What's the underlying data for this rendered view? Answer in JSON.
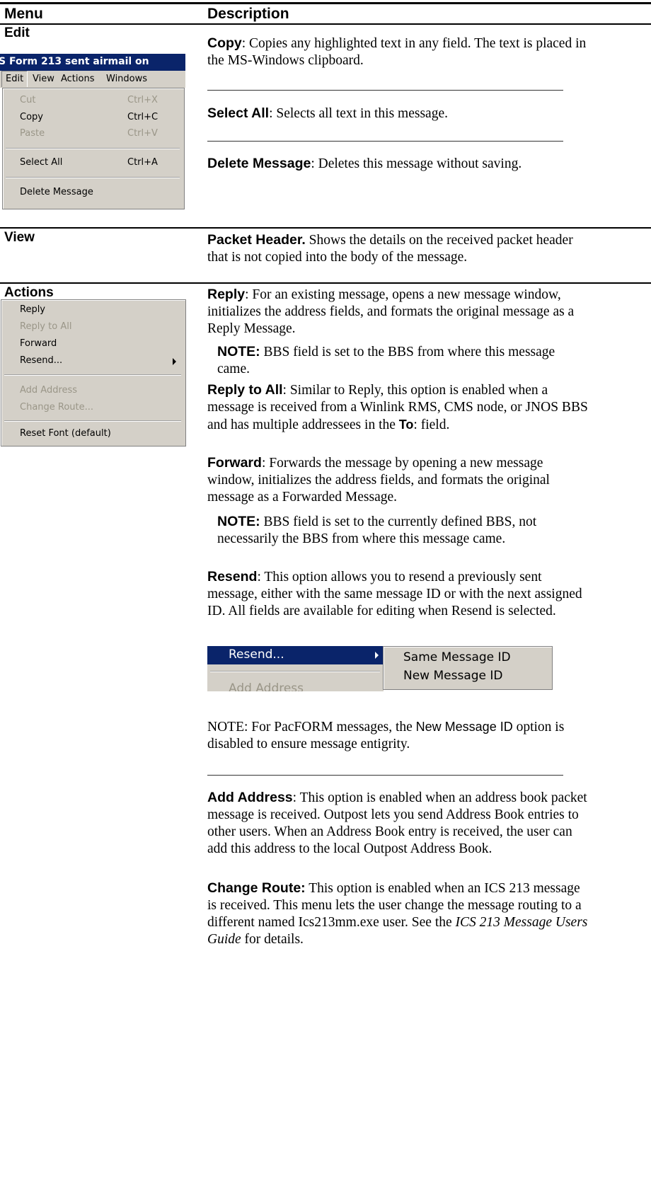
{
  "header": {
    "col_menu": "Menu",
    "col_description": "Description"
  },
  "edit": {
    "label": "Edit",
    "screenshot": {
      "title_bar": "S Form 213 sent airmail on",
      "menubar": [
        "Edit",
        "View",
        "Actions",
        "Windows"
      ],
      "items": [
        {
          "label": "Cut",
          "shortcut": "Ctrl+X",
          "enabled": false
        },
        {
          "label": "Copy",
          "shortcut": "Ctrl+C",
          "enabled": true
        },
        {
          "label": "Paste",
          "shortcut": "Ctrl+V",
          "enabled": false
        },
        {
          "label": "Select All",
          "shortcut": "Ctrl+A",
          "enabled": true
        },
        {
          "label": "Delete Message",
          "shortcut": "",
          "enabled": true
        }
      ]
    },
    "entries": [
      {
        "term": "Copy",
        "text": ": Copies any highlighted text in any field.  The text is placed in the MS-Windows clipboard."
      },
      {
        "term": "Select All",
        "text": ":  Selects all text in this message."
      },
      {
        "term": "Delete Message",
        "text": ": Deletes this message without saving."
      }
    ]
  },
  "view": {
    "label": "View",
    "term": "Packet Header.",
    "text": "  Shows the details on the received packet header that is not copied into the body of the message."
  },
  "actions": {
    "label": "Actions",
    "screenshot": {
      "items": [
        {
          "label": "Reply",
          "enabled": true
        },
        {
          "label": "Reply to All",
          "enabled": false
        },
        {
          "label": "Forward",
          "enabled": true
        },
        {
          "label": "Resend...",
          "enabled": true
        },
        {
          "label": "Add Address",
          "enabled": false
        },
        {
          "label": "Change Route...",
          "enabled": false
        },
        {
          "label": "Reset Font (default)",
          "enabled": true
        }
      ],
      "arrow_icon": "submenu-arrow-icon"
    },
    "reply": {
      "term": "Reply",
      "text": ":  For an existing message, opens a new message window, initializes the address fields, and formats the original message as a Reply Message."
    },
    "reply_note": {
      "term": "NOTE:",
      "text": " BBS field is set to the BBS from where this message came."
    },
    "reply_all": {
      "term": "Reply to All",
      "text_a": ":  Similar to Reply, this option is enabled when a message is received from a Winlink RMS, CMS node, or JNOS BBS and has multiple addressees in the ",
      "to_label": "To",
      "text_b": ": field."
    },
    "forward": {
      "term": "Forward",
      "text": ":  Forwards the message by opening a new message window, initializes the address fields, and formats the original message as a Forwarded Message."
    },
    "forward_note": {
      "term": "NOTE:",
      "text": " BBS field is set to the currently defined BBS, not necessarily the BBS from where this message came."
    },
    "resend": {
      "term": "Resend",
      "text": ":  This option allows you to resend a previously sent message, either with the same message ID or with the next assigned ID.  All fields are available for editing when Resend is selected."
    },
    "resend_screenshot": {
      "item": "Resend...",
      "below_item": "Add Address",
      "submenu": [
        "Same Message ID",
        "New Message ID"
      ],
      "highlight_color": "#0a246a"
    },
    "pacform_note": {
      "text_a": "NOTE: For PacFORM messages, the ",
      "option": "New Message ID",
      "text_b": " option is disabled to ensure message entigrity."
    },
    "add_address": {
      "term": "Add Address",
      "text": ":  This option is enabled when an address book packet message is received.  Outpost lets you send Address Book entries to other users.  When an Address Book entry is received, the user can add this address to the local Outpost Address Book."
    },
    "change_route": {
      "term": "Change Route:",
      "text_a": " This option is enabled when an ICS 213 message is received.  This menu lets the user change the message routing to a different named Ics213mm.exe user.  See the ",
      "guide": "ICS 213 Message Users Guide",
      "text_b": " for details."
    }
  },
  "colors": {
    "menu_bg": "#d4d0c8",
    "title_bar": "#0a246a",
    "disabled_text": "#9a9688"
  }
}
